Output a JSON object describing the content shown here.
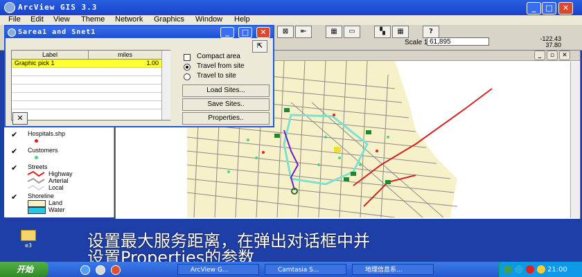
{
  "window": {
    "title": "ArcView GIS 3.3",
    "min": "_",
    "max": "□",
    "close": "✕"
  },
  "menubar": [
    "File",
    "Edit",
    "View",
    "Theme",
    "Network",
    "Graphics",
    "Window",
    "Help"
  ],
  "toolbar": {
    "scale_label": "Scale 1:",
    "scale_value": "61,895",
    "coord_x": "-122.43",
    "coord_y": "37.80"
  },
  "dialog": {
    "title": "Sarea1 and Snet1",
    "columns": [
      "Label",
      "miles"
    ],
    "rows": [
      [
        "Graphic pick 1",
        "1.00"
      ]
    ],
    "options": {
      "compact_area": "Compact area",
      "travel_from": "Travel from site",
      "travel_to": "Travel to site"
    },
    "selected_option": "travel_from",
    "buttons": {
      "load": "Load Sites...",
      "save": "Save Sites..",
      "properties": "Properties.."
    }
  },
  "legend": {
    "hospitals": "Hospitals.shp",
    "customers": "Customers",
    "streets": {
      "title": "Streets",
      "items": [
        "Highway",
        "Arterial",
        "Local"
      ]
    },
    "shoreline": {
      "title": "Shoreline",
      "items": [
        "Land",
        "Water"
      ]
    }
  },
  "desktop_icon_label": "e3",
  "subtitle": {
    "line1": "设置最大服务距离，在弹出对话框中并",
    "line2": "设置Properties的参数"
  },
  "taskbar": {
    "start": "开始",
    "tasks": [
      "ArcView G...",
      "Camtasia S...",
      "地理信息系..."
    ],
    "clock": "21:00"
  },
  "colors": {
    "highway": "#d42020",
    "service_area": "#7fe0d0",
    "route": "#6b1fc8",
    "hospital": "#e02020",
    "customer": "#4fd28a",
    "site": "#1a8a2a"
  }
}
